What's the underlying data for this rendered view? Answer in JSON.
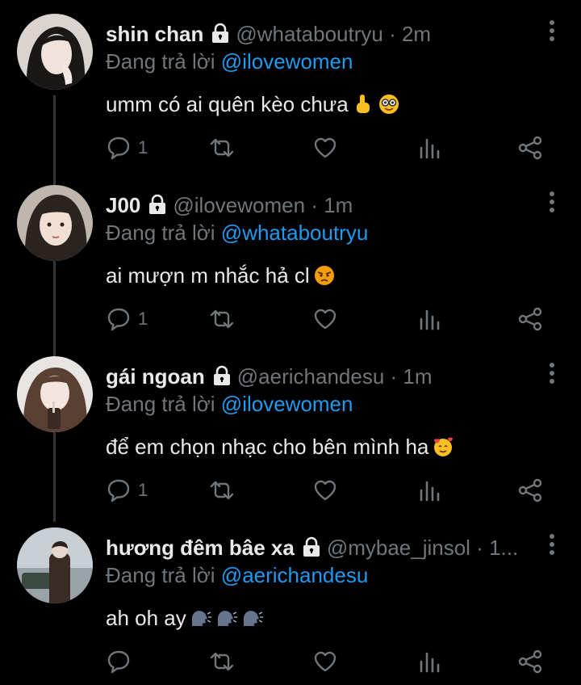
{
  "colors": {
    "background": "#000000",
    "name": "#e7e9ea",
    "secondary": "#71767b",
    "mention": "#1d9bf0",
    "thread_line": "#333639"
  },
  "tweets": [
    {
      "name": "shin chan",
      "handle": "@whataboutryu",
      "time": "· 2m",
      "reply_prefix": "Đang trả lời",
      "reply_to": "@ilovewomen",
      "text": "umm có ai quên kèo chưa",
      "emojis": [
        "pointing-up-emoji",
        "nerd-face-emoji"
      ],
      "reply_count": "1",
      "locked": true
    },
    {
      "name": "J00",
      "handle": "@ilovewomen",
      "time": "· 1m",
      "reply_prefix": "Đang trả lời",
      "reply_to": "@whataboutryu",
      "text": "ai mượn m nhắc hả cl",
      "emojis": [
        "angry-face-emoji"
      ],
      "reply_count": "1",
      "locked": true
    },
    {
      "name": "gái ngoan",
      "handle": "@aerichandesu",
      "time": "· 1m",
      "reply_prefix": "Đang trả lời",
      "reply_to": "@ilovewomen",
      "text": "để em chọn nhạc cho bên mình ha",
      "emojis": [
        "smiling-face-with-hearts-emoji"
      ],
      "reply_count": "1",
      "locked": true
    },
    {
      "name": "hương đêm bâe xa",
      "handle": "@mybae_jinsol",
      "time": "· 1...",
      "reply_prefix": "Đang trả lời",
      "reply_to": "@aerichandesu",
      "text": "ah oh ay",
      "emojis": [
        "speaking-head-emoji",
        "speaking-head-emoji",
        "speaking-head-emoji"
      ],
      "reply_count": "",
      "locked": true
    }
  ]
}
